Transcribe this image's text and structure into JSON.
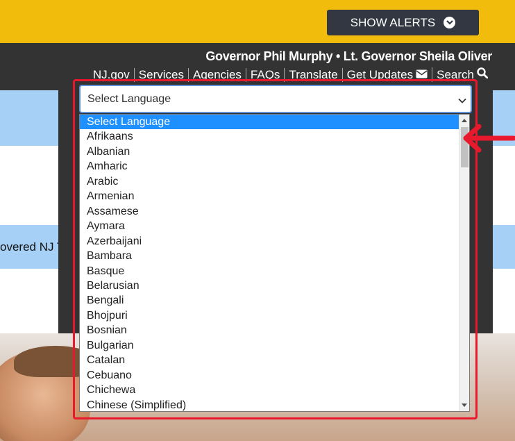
{
  "alerts": {
    "label": "SHOW ALERTS",
    "icon": "chevron-down-circle-icon"
  },
  "header": {
    "governor_line": "Governor Phil Murphy • Lt. Governor Sheila Oliver",
    "nav": [
      {
        "label": "NJ.gov"
      },
      {
        "label": "Services"
      },
      {
        "label": "Agencies"
      },
      {
        "label": "FAQs"
      },
      {
        "label": "Translate"
      },
      {
        "label": "Get Updates",
        "icon": "envelope-icon"
      },
      {
        "label": "Search",
        "icon": "search-icon"
      }
    ]
  },
  "banner": {
    "partial_text": "overed NJ T"
  },
  "language_select": {
    "selected": "Select Language",
    "options": [
      "Select Language",
      "Afrikaans",
      "Albanian",
      "Amharic",
      "Arabic",
      "Armenian",
      "Assamese",
      "Aymara",
      "Azerbaijani",
      "Bambara",
      "Basque",
      "Belarusian",
      "Bengali",
      "Bhojpuri",
      "Bosnian",
      "Bulgarian",
      "Catalan",
      "Cebuano",
      "Chichewa",
      "Chinese (Simplified)"
    ],
    "highlighted_index": 0
  },
  "colors": {
    "alert_bar": "#f2bc0c",
    "header_bg": "#333333",
    "band": "#a7d0f6",
    "selection": "#1e90ff",
    "annotation": "#e8192c"
  }
}
